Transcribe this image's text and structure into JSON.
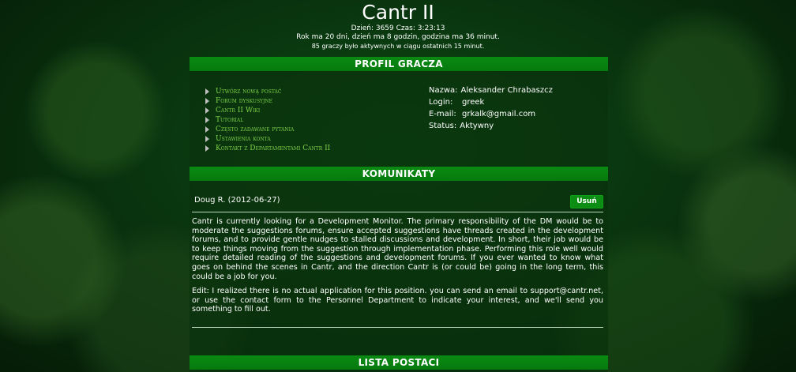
{
  "header": {
    "title": "Cantr II",
    "line1": "Dzień: 3659 Czas: 3:23:13",
    "line2": "Rok ma 20 dni, dzień ma 8 godzin, godzina ma 36 minut.",
    "line3": "85 graczy było aktywnych w ciągu ostatnich 15 minut."
  },
  "profile_section": {
    "title": "PROFIL GRACZA",
    "menu": [
      {
        "label": "Utwórz nową postać"
      },
      {
        "label": "Forum dyskusyjne"
      },
      {
        "label": "Cantr II Wiki"
      },
      {
        "label": "Tutorial"
      },
      {
        "label": "Często zadawane pytania"
      },
      {
        "label": "Ustawienia konta"
      },
      {
        "label": "Kontakt z Departamentami Cantr II"
      }
    ],
    "info": {
      "name_label": "Nazwa:",
      "name_value": "Aleksander Chrabaszcz",
      "login_label": "Login:",
      "login_value": "greek",
      "email_label": "E-mail:",
      "email_value": "grkalk@gmail.com",
      "status_label": "Status:",
      "status_value": "Aktywny"
    }
  },
  "messages_section": {
    "title": "KOMUNIKATY",
    "author": "Doug R. (2012-06-27)",
    "delete_label": "Usuń",
    "paragraph1": "Cantr is currently looking for a Development Monitor. The primary responsibility of the DM would be to moderate the suggestions forums, ensure accepted suggestions have threads created in the development forums, and to provide gentle nudges to stalled discussions and development. In short, their job would be to keep things moving from the suggestion through implementation phase. Performing this role well would require detailed reading of the suggestions and development forums. If you ever wanted to know what goes on behind the scenes in Cantr, and the direction Cantr is (or could be) going in the long term, this could be a job for you.",
    "paragraph2": "Edit: I realized there is no actual application for this position. you can send an email to support@cantr.net, or use the contact form to the Personnel Department to indicate your interest, and we'll send you something to fill out."
  },
  "characters_section": {
    "title": "LISTA POSTACI"
  }
}
